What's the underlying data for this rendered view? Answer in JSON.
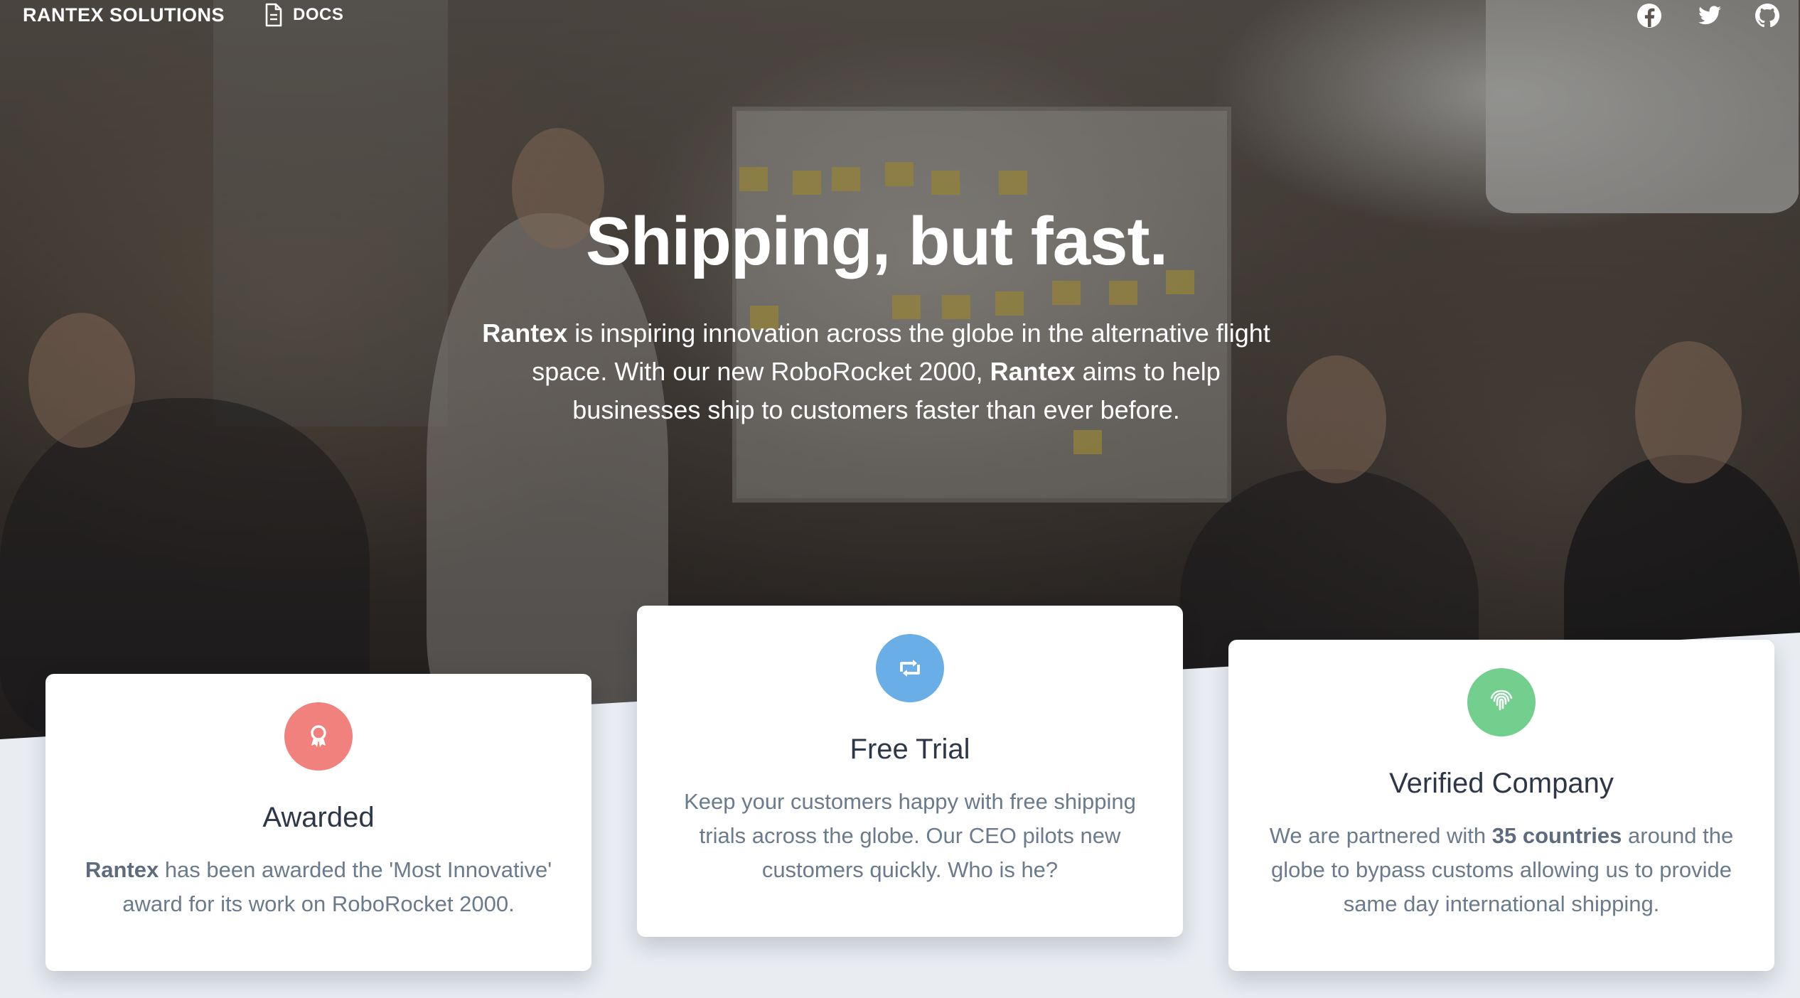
{
  "nav": {
    "brand": "RANTEX SOLUTIONS",
    "docs_label": "DOCS",
    "social": [
      "facebook-icon",
      "twitter-icon",
      "github-icon"
    ]
  },
  "hero": {
    "title": "Shipping, but fast.",
    "text_line1_bold": "Rantex",
    "text_line1_rest": " is inspiring innovation across the globe in the alternative flight",
    "text_line2_start": "space. With our new RoboRocket 2000, ",
    "text_line2_bold": "Rantex",
    "text_line2_rest": " aims to help",
    "text_line3": "businesses ship to customers faster than ever before."
  },
  "cards": [
    {
      "icon": "award-icon",
      "icon_color": "#f0817d",
      "title": "Awarded",
      "desc_bold": "Rantex",
      "desc_rest": " has been awarded the 'Most Innovative' award for its work on RoboRocket 2000."
    },
    {
      "icon": "retweet-icon",
      "icon_color": "#6aaee8",
      "title": "Free Trial",
      "desc": "Keep your customers happy with free shipping trials across the globe. Our CEO pilots new customers quickly. Who is he?"
    },
    {
      "icon": "fingerprint-icon",
      "icon_color": "#72cf8e",
      "title": "Verified Company",
      "desc_start": "We are partnered with ",
      "desc_bold": "35 countries",
      "desc_rest": " around the globe to bypass customs allowing us to provide same day international shipping."
    }
  ],
  "colors": {
    "page_bg": "#e9edf2",
    "card_title": "#2d3748",
    "card_text": "#6b7a8d"
  }
}
